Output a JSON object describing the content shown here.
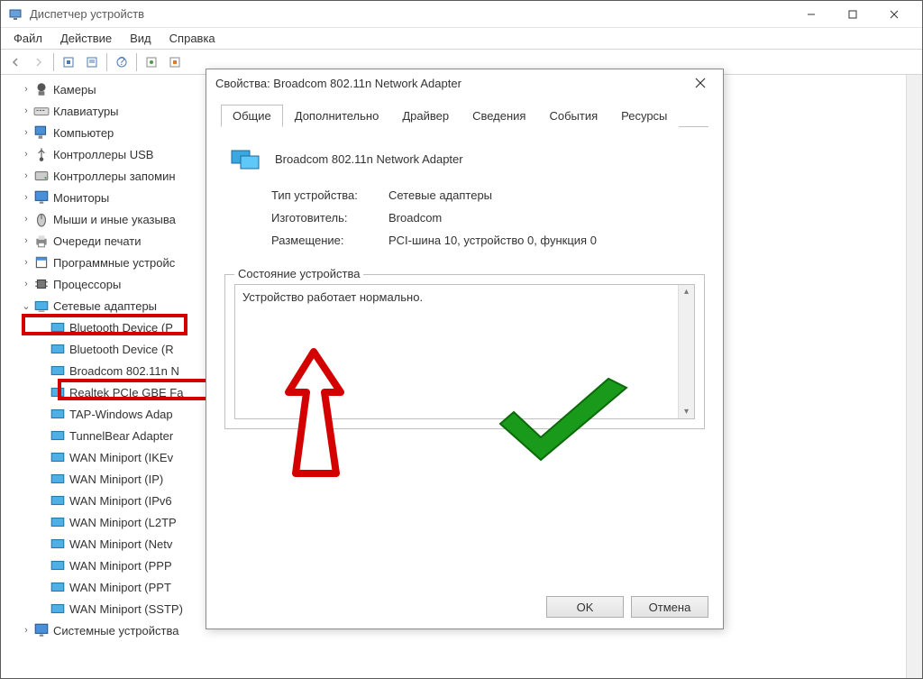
{
  "window": {
    "title": "Диспетчер устройств",
    "menu": {
      "file": "Файл",
      "action": "Действие",
      "view": "Вид",
      "help": "Справка"
    }
  },
  "tree": {
    "items": [
      {
        "label": "Камеры",
        "icon": "camera"
      },
      {
        "label": "Клавиатуры",
        "icon": "keyboard"
      },
      {
        "label": "Компьютер",
        "icon": "pc"
      },
      {
        "label": "Контроллеры USB",
        "icon": "usb"
      },
      {
        "label": "Контроллеры запомин",
        "icon": "disk"
      },
      {
        "label": "Мониторы",
        "icon": "monitor"
      },
      {
        "label": "Мыши и иные указыва",
        "icon": "mouse"
      },
      {
        "label": "Очереди печати",
        "icon": "printer"
      },
      {
        "label": "Программные устройс",
        "icon": "sw"
      },
      {
        "label": "Процессоры",
        "icon": "cpu"
      }
    ],
    "netadapters_label": "Сетевые адаптеры",
    "netadapters": [
      "Bluetooth Device (P",
      "Bluetooth Device (R",
      "Broadcom 802.11n N",
      "Realtek PCIe GBE Fa",
      "TAP-Windows Adap",
      "TunnelBear Adapter",
      "WAN Miniport (IKEv",
      "WAN Miniport (IP)",
      "WAN Miniport (IPv6",
      "WAN Miniport (L2TP",
      "WAN Miniport (Netv",
      "WAN Miniport (PPP",
      "WAN Miniport (PPT",
      "WAN Miniport (SSTP)"
    ],
    "sysdev_label": "Системные устройства"
  },
  "dialog": {
    "title": "Свойства: Broadcom 802.11n Network Adapter",
    "tabs": {
      "general": "Общие",
      "advanced": "Дополнительно",
      "driver": "Драйвер",
      "details": "Сведения",
      "events": "События",
      "resources": "Ресурсы"
    },
    "device_name": "Broadcom 802.11n Network Adapter",
    "labels": {
      "type": "Тип устройства:",
      "mfg": "Изготовитель:",
      "loc": "Размещение:",
      "status_group": "Состояние устройства"
    },
    "values": {
      "type": "Сетевые адаптеры",
      "mfg": "Broadcom",
      "loc": "PCI-шина 10, устройство 0, функция 0"
    },
    "status_text": "Устройство работает нормально.",
    "ok": "OK",
    "cancel": "Отмена"
  }
}
